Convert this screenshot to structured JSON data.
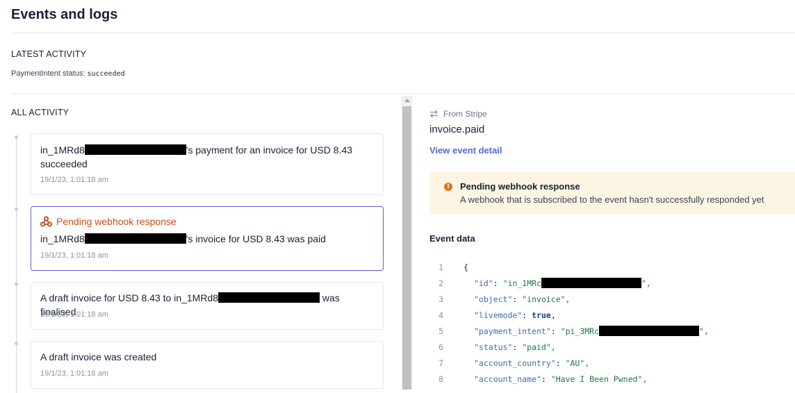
{
  "header": {
    "title": "Events and logs"
  },
  "latest": {
    "label": "LATEST ACTIVITY",
    "status_label": "PaymentIntent status:",
    "status_value": "succeeded"
  },
  "activity": {
    "label": "ALL ACTIVITY",
    "items": [
      {
        "prefix": "in_1MRd8",
        "suffix": "'s payment for an invoice for USD 8.43",
        "line2": "succeeded",
        "time": "19/1/23, 1:01:18 am"
      },
      {
        "badge": "Pending webhook response",
        "prefix": "in_1MRd8",
        "suffix": "'s invoice for USD 8.43 was paid",
        "time": "19/1/23, 1:01:18 am"
      },
      {
        "prefix": "A draft invoice for USD 8.43 to in_1MRd8",
        "suffix": " was finalised",
        "time": "19/1/23, 1:01:18 am"
      },
      {
        "text": "A draft invoice was created",
        "time": "19/1/23, 1:01:18 am"
      }
    ]
  },
  "detail": {
    "source": "From Stripe",
    "event": "invoice.paid",
    "link": "View event detail",
    "alert_title": "Pending webhook response",
    "alert_body": "A webhook that is subscribed to the event hasn't successfully responded yet",
    "data_label": "Event data"
  },
  "code": {
    "line_numbers": [
      "1",
      "2",
      "3",
      "4",
      "5",
      "6",
      "7",
      "8"
    ],
    "brace": "{",
    "id_key": "\"id\"",
    "id_val_prefix": "\"in_1MRc",
    "id_val_suffix": "\",",
    "object_key": "\"object\"",
    "object_val": "\"invoice\",",
    "livemode_key": "\"livemode\"",
    "livemode_val": "true",
    "pi_key": "\"payment_intent\"",
    "pi_val_prefix": "\"pi_3MRc",
    "pi_val_suffix": "\",",
    "status_key": "\"status\"",
    "status_val": "\"paid\",",
    "country_key": "\"account_country\"",
    "country_val": "\"AU\",",
    "name_key": "\"account_name\"",
    "name_val": "\"Have I Been Pwned\","
  },
  "colors": {
    "accent": "#5469d4",
    "selected_border": "#6d6ae0",
    "pending": "#c4501b",
    "alert_bg": "#fcf5e3",
    "alert_icon": "#e5731a"
  }
}
